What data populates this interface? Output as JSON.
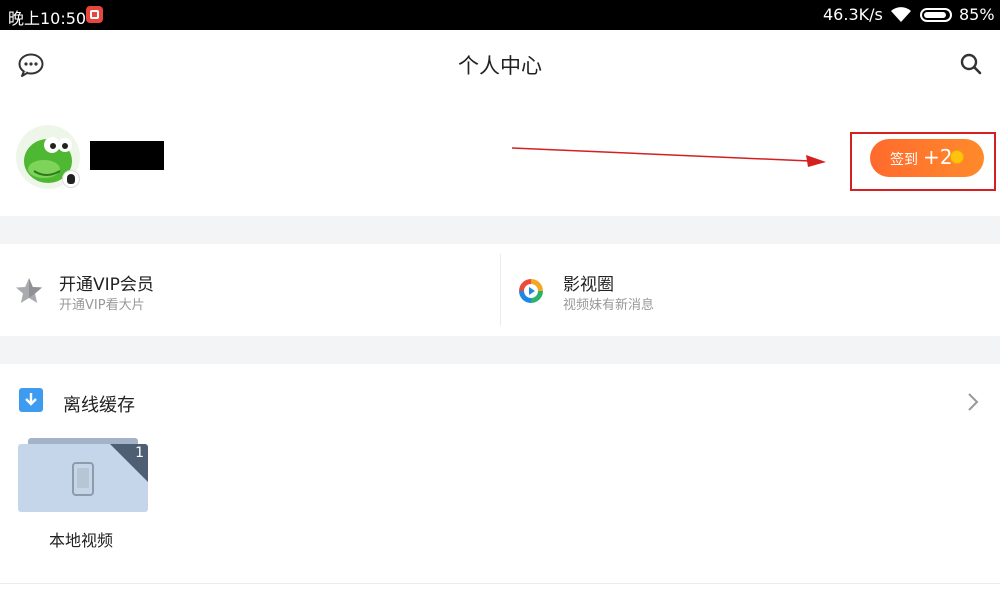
{
  "status_bar": {
    "time": "晚上10:50",
    "speed": "46.3K/s",
    "battery": "85%",
    "battery_level": 0.85
  },
  "header": {
    "title": "个人中心",
    "left_icon": "chat-bubble-icon",
    "right_icon": "search-icon"
  },
  "profile": {
    "name_redacted": true,
    "signin_label": "签到",
    "signin_reward": "+2",
    "reward_icon": "coin-icon",
    "accent_color": "#ff6a2d",
    "annotation_color": "#d42020"
  },
  "menu": {
    "vip": {
      "title": "开通VIP会员",
      "subtitle": "开通VIP看大片",
      "icon": "star-icon"
    },
    "circle": {
      "title": "影视圈",
      "subtitle": "视频妹有新消息",
      "icon": "play-circle-icon"
    }
  },
  "offline": {
    "title": "离线缓存",
    "icon": "download-icon",
    "folder": {
      "label": "本地视频",
      "count": "1",
      "icon": "phone-icon"
    }
  }
}
